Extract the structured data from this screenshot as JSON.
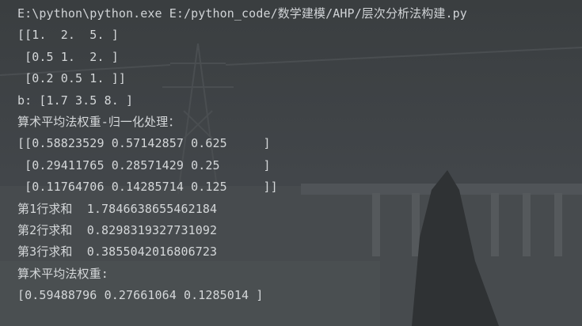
{
  "console": {
    "lines": [
      "E:\\python\\python.exe E:/python_code/数学建模/AHP/层次分析法构建.py",
      "[[1.  2.  5. ]",
      " [0.5 1.  2. ]",
      " [0.2 0.5 1. ]]",
      "b: [1.7 3.5 8. ]",
      "算术平均法权重-归一化处理：",
      "[[0.58823529 0.57142857 0.625     ]",
      " [0.29411765 0.28571429 0.25      ]",
      " [0.11764706 0.14285714 0.125     ]]",
      "第1行求和  1.7846638655462184",
      "第2行求和  0.8298319327731092",
      "第3行求和  0.3855042016806723",
      "算术平均法权重:",
      "[0.59488796 0.27661064 0.1285014 ]"
    ]
  },
  "colors": {
    "background": "#3b3f41",
    "text": "#d4d7d9"
  }
}
